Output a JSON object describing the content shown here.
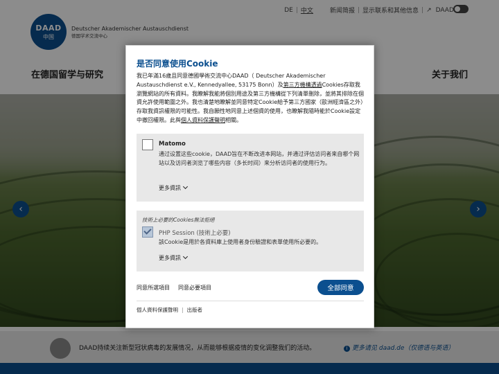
{
  "header": {
    "logo_main": "DAAD",
    "logo_sub": "中国",
    "org_name": "Deutscher Akademischer Austauschdienst",
    "org_name_cn": "德国学术交流中心",
    "lang_de": "DE",
    "lang_cn": "中文",
    "link_news": "新闻简报",
    "link_contact": "显示联系和其他信息",
    "link_daad": "DAAD.de",
    "nav_left": "在德国留学与研究",
    "nav_right": "关于我们"
  },
  "hero": {
    "prev_icon": "chevron-left-icon",
    "next_icon": "chevron-right-icon"
  },
  "notice": {
    "text": "DAAD持续关注新型冠状病毒的发展情况，从而能够根据疫情的变化调整我们的活动。",
    "more": "更多请见 daad.de（仅德语与英语）"
  },
  "modal": {
    "title": "是否同意使用Cookie",
    "intro_1": "我已年滿16歲且同意德國學術交流中心DAAD（ Deutscher Akademischer Austauschdienst e.V., Kennedyallee, 53175 Bonn）及",
    "intro_link_1": "第三方機構透過",
    "intro_2": "Cookies存取我瀏覽網站的所有資料。我瞭解我能將個別用途及第三方機構從下列清單刪除，並將其排除在個資允許使用範圍之外。我也清楚地瞭解並同意特定Cookie給予第三方國家（歐洲經濟區之外）存取我資訊權限的可能性。我自願性地同意上述個資的使用，也瞭解我隨時能於Cookie設定中撤回權限。此與",
    "intro_link_2": "個人資料保護聲明",
    "intro_3": "相關。",
    "matomo": {
      "name": "Matomo",
      "desc": "通过设置这些cookie，DAAD旨在不断改进本网站，并通过评估访问者来自哪个网站以及访问者浏览了哪些内容（多长时间）来分析访问者的使用行为。",
      "more": "更多資訊"
    },
    "required": {
      "note": "技術上必要的Cookies無法拒絕",
      "name": "PHP Session (技術上必要)",
      "desc": "該Cookie是用於各資料庫上使用者身份驗證和表單使用所必要的。",
      "more": "更多資訊"
    },
    "btn_agree_selected": "同意所選項目",
    "btn_agree_necessary": "同意必要項目",
    "btn_agree_all": "全部同意",
    "footer_privacy": "個人資料保護聲明",
    "footer_imprint": "出版者"
  }
}
